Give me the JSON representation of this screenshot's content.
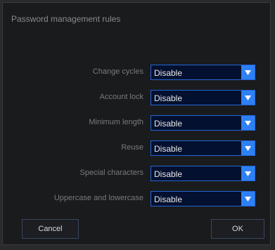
{
  "dialog": {
    "title": "Password management rules",
    "rules": [
      {
        "label": "Change cycles",
        "value": "Disable"
      },
      {
        "label": "Account lock",
        "value": "Disable"
      },
      {
        "label": "Minimum length",
        "value": "Disable"
      },
      {
        "label": "Reuse",
        "value": "Disable"
      },
      {
        "label": "Special characters",
        "value": "Disable"
      },
      {
        "label": "Uppercase and lowercase",
        "value": "Disable"
      }
    ],
    "buttons": {
      "cancel": "Cancel",
      "ok": "OK"
    }
  },
  "colors": {
    "background": "#1a1b1d",
    "select_bg": "#04102f",
    "select_border": "#2266d6",
    "arrow_bg": "#2e80f4",
    "label": "#7a7a7a"
  }
}
